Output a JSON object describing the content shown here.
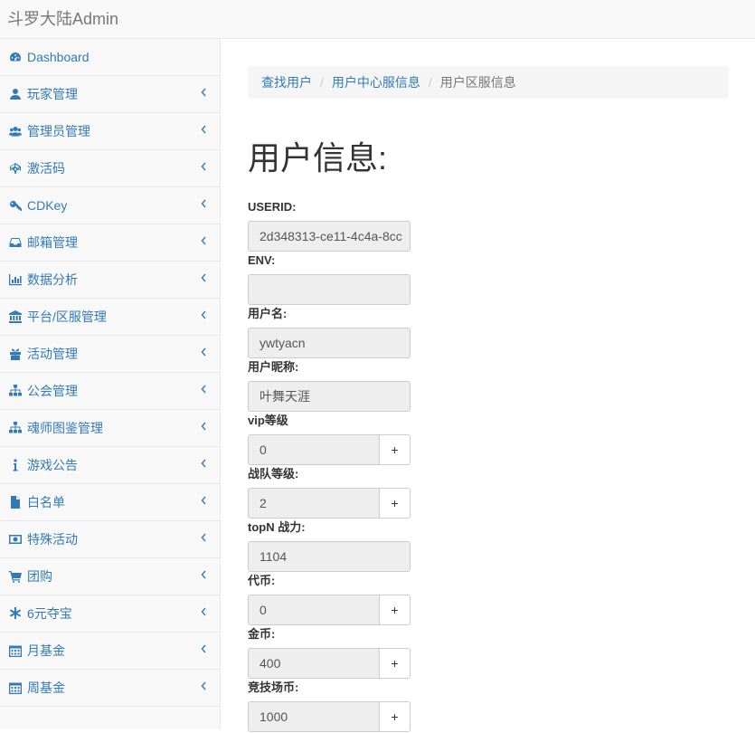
{
  "app": {
    "brand": "斗罗大陆Admin"
  },
  "sidebar": {
    "items": [
      {
        "label": "Dashboard",
        "icon": "dashboard-icon",
        "has_chevron": false
      },
      {
        "label": "玩家管理",
        "icon": "user-icon",
        "has_chevron": true
      },
      {
        "label": "管理员管理",
        "icon": "users-icon",
        "has_chevron": true
      },
      {
        "label": "激活码",
        "icon": "codepen-icon",
        "has_chevron": true
      },
      {
        "label": "CDKey",
        "icon": "key-icon",
        "has_chevron": true
      },
      {
        "label": "邮箱管理",
        "icon": "inbox-icon",
        "has_chevron": true
      },
      {
        "label": "数据分析",
        "icon": "bar-chart-icon",
        "has_chevron": true
      },
      {
        "label": "平台/区服管理",
        "icon": "bank-icon",
        "has_chevron": true
      },
      {
        "label": "活动管理",
        "icon": "gift-icon",
        "has_chevron": true
      },
      {
        "label": "公会管理",
        "icon": "sitemap-icon",
        "has_chevron": true
      },
      {
        "label": "魂师图鉴管理",
        "icon": "sitemap-icon",
        "has_chevron": true
      },
      {
        "label": "游戏公告",
        "icon": "info-icon",
        "has_chevron": true
      },
      {
        "label": "白名单",
        "icon": "file-icon",
        "has_chevron": true
      },
      {
        "label": "特殊活动",
        "icon": "money-icon",
        "has_chevron": true
      },
      {
        "label": "团购",
        "icon": "cart-icon",
        "has_chevron": true
      },
      {
        "label": "6元夺宝",
        "icon": "asterisk-icon",
        "has_chevron": true
      },
      {
        "label": "月基金",
        "icon": "calendar-icon",
        "has_chevron": true
      },
      {
        "label": "周基金",
        "icon": "calendar-icon",
        "has_chevron": true
      }
    ]
  },
  "breadcrumb": {
    "items": [
      "查找用户",
      "用户中心服信息"
    ],
    "active": "用户区服信息",
    "separator": "/"
  },
  "page": {
    "title": "用户信息:"
  },
  "form": {
    "fields": [
      {
        "label": "USERID:",
        "value": "2d348313-ce11-4c4a-8cc",
        "has_plus": false
      },
      {
        "label": "ENV:",
        "value": "",
        "has_plus": false
      },
      {
        "label": "用户名:",
        "value": "ywtyacn",
        "has_plus": false
      },
      {
        "label": "用户昵称:",
        "value": "叶舞天涯",
        "has_plus": false
      },
      {
        "label": "vip等级",
        "value": "0",
        "has_plus": true
      },
      {
        "label": "战队等级:",
        "value": "2",
        "has_plus": true
      },
      {
        "label": "topN 战力:",
        "value": "1104",
        "has_plus": false
      },
      {
        "label": "代币:",
        "value": "0",
        "has_plus": true
      },
      {
        "label": "金币:",
        "value": "400",
        "has_plus": true
      },
      {
        "label": "竞技场币:",
        "value": "1000",
        "has_plus": true
      }
    ],
    "plus_label": "+"
  },
  "colors": {
    "link": "#337ab7",
    "sidebar_bg": "#f8f8f8",
    "input_bg": "#eeeeee"
  }
}
